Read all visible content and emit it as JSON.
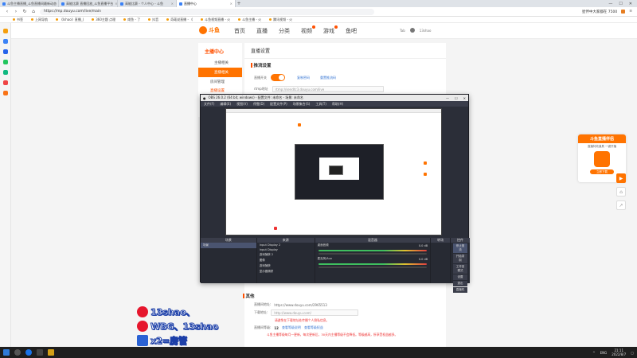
{
  "browser": {
    "tabs": [
      {
        "label": "斗鱼主播直播_斗鱼直播间最新动态",
        "active": false
      },
      {
        "label": "高能比赛 直播回放_斗鱼直播平台",
        "active": false
      },
      {
        "label": "高能比赛 - 个人中心 - 斗鱼",
        "active": false
      },
      {
        "label": "直播中心",
        "active": true
      }
    ],
    "newtab": "+",
    "window_controls": [
      "—",
      "☐",
      "✕"
    ],
    "address": "https://mp.douyu.com/live/main",
    "promo_text": "星伴中大家都在 7500",
    "bookmarks": [
      "书签",
      "上网导航",
      "《Ishao》直播_(",
      "360主题 点理",
      "咸鱼 - 了",
      "抖音",
      "奇葩说直播 - 《",
      "斗鱼视频直播 - 火",
      "斗鱼主播 - 火",
      "腾讯视频 - 火"
    ]
  },
  "site": {
    "brand": "斗鱼",
    "nav": [
      "首页",
      "直播",
      "分类",
      "视频",
      "游戏",
      "鱼吧"
    ],
    "nav_badges": [
      false,
      false,
      false,
      true,
      true,
      false
    ],
    "user_label": "Tab",
    "username": "13shao"
  },
  "leftmenu": {
    "title": "主播中心",
    "items": [
      {
        "label": "主播相关",
        "active": false
      },
      {
        "label": "直播相关",
        "active": true
      }
    ],
    "subs": [
      {
        "label": "房间管理",
        "active": false
      },
      {
        "label": "直播设置",
        "active": true
      }
    ]
  },
  "content": {
    "header": "直播设置",
    "section_title": "推流设置",
    "toggle_label": "直播开关",
    "link_copy": "复制密码",
    "link_reset": "重置推流码",
    "rtmp_label": "rtmp地址",
    "rtmp_value": "rtmp://sendtc3.douyu.com/live"
  },
  "obs": {
    "title": "OBS 26.0.2 (64 bit, windows) - 配置文件: 未命名 - 场景: 未命名",
    "menu": [
      "文件(F)",
      "编辑(E)",
      "视图(V)",
      "停靠(D)",
      "配置文件(P)",
      "场景集合(S)",
      "工具(T)",
      "帮助(H)"
    ],
    "panels": {
      "scenes": {
        "title": "场景",
        "items": [
          "场景"
        ]
      },
      "sources": {
        "title": "来源",
        "items": [
          "Input Display 2",
          "Input Display",
          "游戏捕获 2",
          "图像",
          "游戏捕获",
          "显示器捕获"
        ]
      },
      "mixer": {
        "title": "混音器",
        "tracks": [
          "桌面音频",
          "麦克风/Aux"
        ],
        "levels": [
          "0.0 dB",
          "0.0 dB"
        ]
      },
      "transitions": {
        "title": "转场"
      },
      "controls": {
        "title": "控件",
        "buttons": [
          "停止推流",
          "开始录制",
          "工作室模式",
          "设置",
          "退出",
          "直播机"
        ]
      }
    },
    "status": [
      "LIVE: 00:00:00",
      "REC: 00:00:00",
      "CPU: 8.6%, 60.00 fps"
    ]
  },
  "other": {
    "title": "其他",
    "room_label": "直播间地址:",
    "room_value": "https://www.douyu.com/2965513",
    "download_label": "下载地址:",
    "download_value": "http://www.douyu.com/",
    "download_warn": "请避免在下载地址处传播个人隐私信息。",
    "level_label": "直播间等级:",
    "level_value": "12",
    "level_link1": "查看等级说明",
    "level_link2": "查看等级权益",
    "note": "斗鱼主播等级每月一更新，每次更新后，30天内主播等级不会降低。等级越高，所享受权益越多。"
  },
  "overlay": {
    "line1": "13shao、",
    "line2": "WBG、13shao",
    "line3": "x2=房管"
  },
  "promo": {
    "title": "斗鱼直播伴侣",
    "sub": "直播特效道具 一键开播",
    "download": "立即下载"
  },
  "taskbar": {
    "lang": "ENG",
    "time": "21:11",
    "date": "2022/8/7"
  },
  "colors": {
    "accent": "#ff7300",
    "link": "#3a78d4",
    "warning": "#e33333",
    "obs_bg": "#2b2e38"
  }
}
